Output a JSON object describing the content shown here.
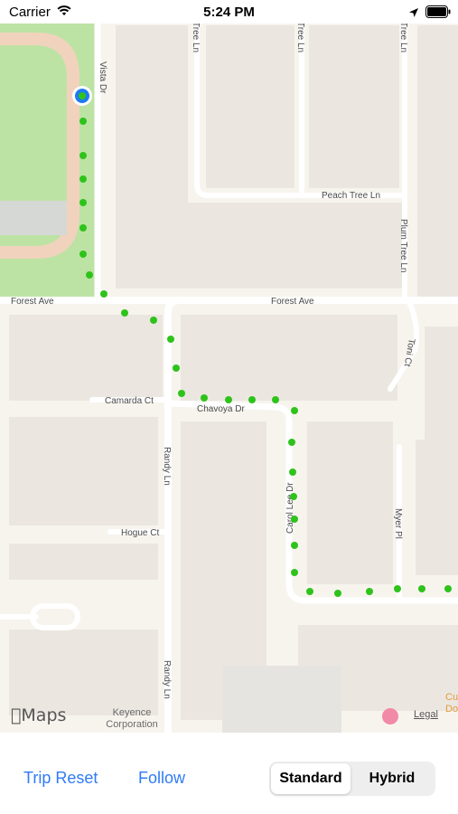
{
  "status_bar": {
    "carrier": "Carrier",
    "time": "5:24 PM",
    "icons": [
      "wifi-icon",
      "location-arrow-icon",
      "battery-icon"
    ]
  },
  "map": {
    "streets": {
      "vista_dr": "Vista Dr",
      "forest_ave_west": "Forest Ave",
      "forest_ave_east": "Forest Ave",
      "peach_tree_ln": "Peach Tree Ln",
      "tree_ln_1": "Tree Ln",
      "tree_ln_2": "Tree Ln",
      "tree_ln_3": "Tree Ln",
      "plum_tree_ln": "Plum Tree Ln",
      "toni_ct": "Toni Ct",
      "camarda_ct": "Camarda Ct",
      "chavoya_dr": "Chavoya Dr",
      "randy_ln_1": "Randy Ln",
      "randy_ln_2": "Randy Ln",
      "carol_lee_dr": "Carol Lee Dr",
      "myer_pl": "Myer Pl",
      "hogue_ct": "Hogue Ct"
    },
    "places": {
      "keyence_1": "Keyence",
      "keyence_2": "Corporation",
      "partial_1": "Cu",
      "partial_2": "Do"
    },
    "attribution": "Maps",
    "legal": "Legal",
    "colors": {
      "background": "#f7f4ee",
      "road": "#ffffff",
      "park": "#bde3a4",
      "track": "#f1d3bd",
      "trail_dot": "#2ec31b",
      "user_location": "#1e7cf2"
    }
  },
  "controls": {
    "trip_reset": "Trip Reset",
    "follow": "Follow",
    "map_type": {
      "options": [
        "Standard",
        "Hybrid"
      ],
      "selected": "Standard"
    }
  }
}
